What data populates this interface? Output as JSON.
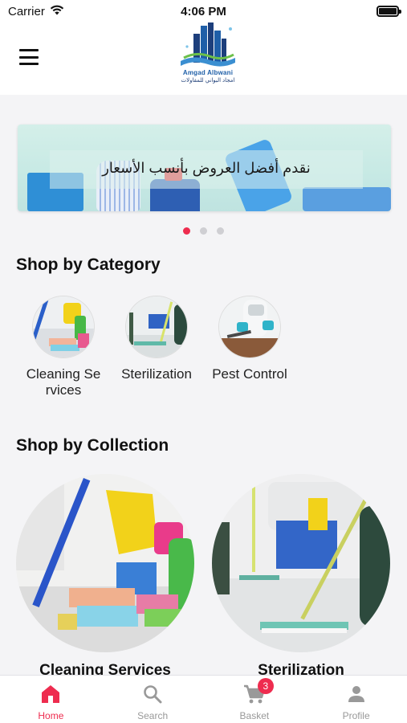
{
  "status_bar": {
    "carrier": "Carrier",
    "time": "4:06 PM"
  },
  "header": {
    "logo_name_en": "Amgad Albwani",
    "logo_name_ar": "امجاد البواني للمقاولات"
  },
  "banner": {
    "text": "نقدم أفضل العروض بأنسب الأسعار",
    "active_slide": 1,
    "slide_count": 3
  },
  "categories_section": {
    "title": "Shop by Category",
    "items": [
      {
        "label": "Cleaning Services"
      },
      {
        "label": "Sterilization"
      },
      {
        "label": "Pest Control"
      }
    ]
  },
  "collections_section": {
    "title": "Shop by Collection",
    "items": [
      {
        "label": "Cleaning Services"
      },
      {
        "label": "Sterilization"
      }
    ]
  },
  "tab_bar": {
    "items": [
      {
        "label": "Home",
        "icon": "home-icon",
        "active": true
      },
      {
        "label": "Search",
        "icon": "search-icon",
        "active": false
      },
      {
        "label": "Basket",
        "icon": "cart-icon",
        "active": false,
        "badge": "3"
      },
      {
        "label": "Profile",
        "icon": "person-icon",
        "active": false
      }
    ]
  },
  "colors": {
    "accent": "#ee2c4f",
    "inactive_tab": "#999999",
    "background": "#f4f4f6"
  }
}
